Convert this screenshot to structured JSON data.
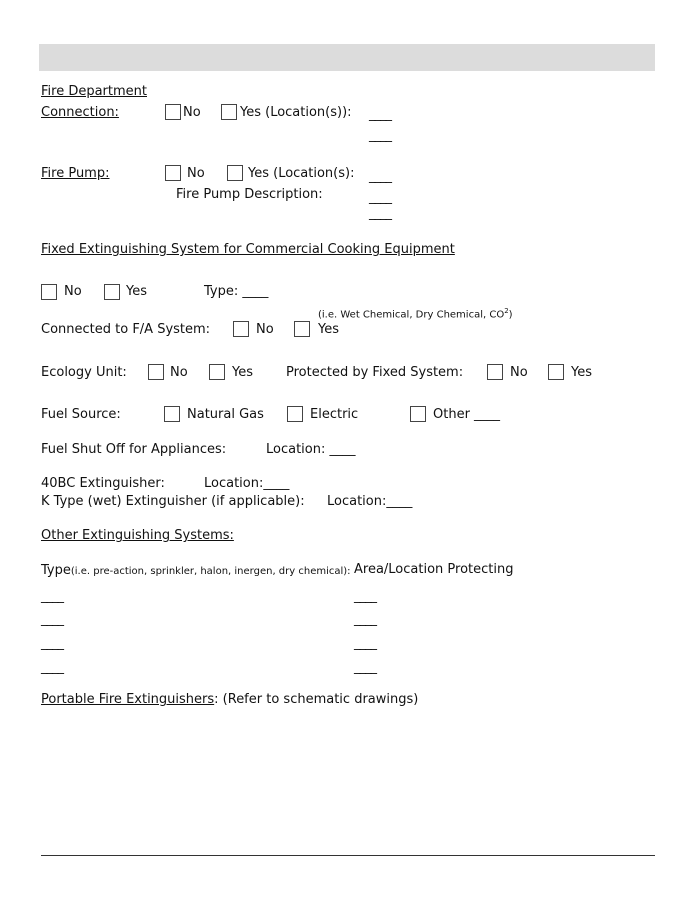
{
  "header_bar": "",
  "fdc": {
    "title1": "Fire Department",
    "title2": "Connection:",
    "no": "No",
    "yes": "Yes (Location(s)):",
    "blank": "____"
  },
  "pump": {
    "title": "Fire Pump:",
    "no": "No",
    "yes": "Yes (Location(s):",
    "desc": "Fire Pump Description:",
    "blank": "____"
  },
  "cooking": {
    "heading": "Fixed Extinguishing System for Commercial Cooking Equipment",
    "no": "No",
    "yes": "Yes",
    "type": "Type: ____",
    "note": "(i.e. Wet Chemical, Dry Chemical, CO",
    "note_sup": "2",
    "note_end": ")",
    "fa_label": "Connected to F/A System:",
    "fa_no": "No",
    "fa_yes": "Yes"
  },
  "ecology": {
    "label": "Ecology Unit:",
    "no": "No",
    "yes": "Yes",
    "protected": "Protected by Fixed System:",
    "p_no": "No",
    "p_yes": "Yes"
  },
  "fuel": {
    "label": "Fuel Source:",
    "natural_gas": "Natural Gas",
    "electric": "Electric",
    "other": "Other ____"
  },
  "shutoff": {
    "label": "Fuel Shut Off for Appliances:",
    "location": "Location: ____"
  },
  "bc": {
    "label": "40BC Extinguisher:",
    "location": "Location:____"
  },
  "k": {
    "label": "K Type (wet) Extinguisher (if applicable):",
    "location": "Location:____"
  },
  "other": {
    "heading": "Other Extinguishing Systems:",
    "type": "Type",
    "type_note": "(i.e. pre-action, sprinkler, halon, inergen, dry chemical):",
    "area": "Area/Location Protecting",
    "blank": "____"
  },
  "portable": {
    "label": "Portable Fire Extinguishers",
    "rest": ": (Refer to schematic drawings)"
  }
}
